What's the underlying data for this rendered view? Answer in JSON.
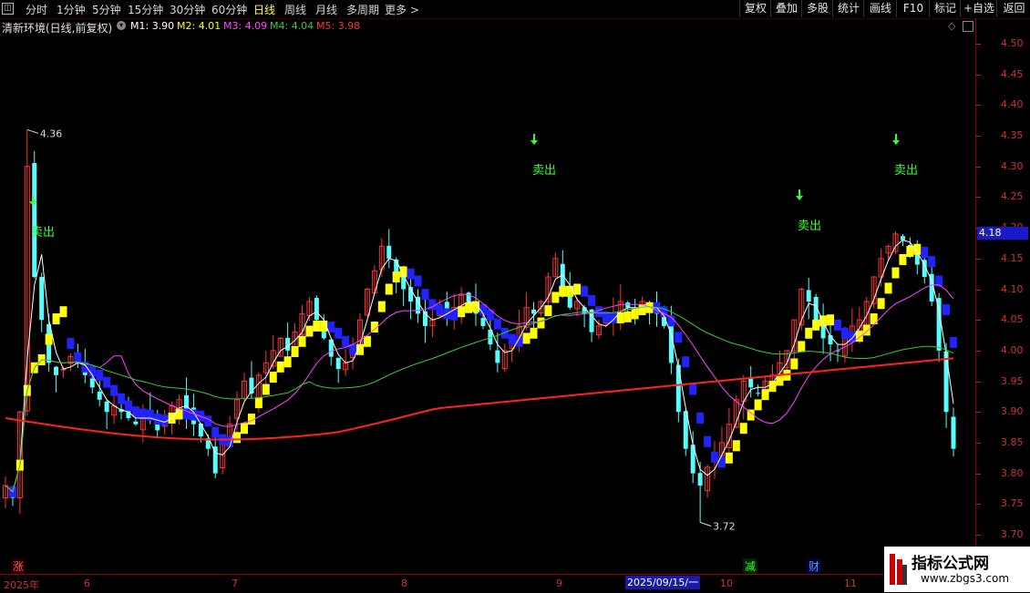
{
  "toolbar": {
    "timeframes": [
      "分时",
      "1分钟",
      "5分钟",
      "15分钟",
      "30分钟",
      "60分钟",
      "日线",
      "周线",
      "月线",
      "多周期",
      "更多 >"
    ],
    "active_index": 6,
    "right_buttons": [
      "复权",
      "叠加",
      "多股",
      "统计",
      "画线",
      "F10",
      "+自选",
      "返回"
    ]
  },
  "info": {
    "title": "清新环境(日线,前复权)",
    "m1": "M1: 3.90",
    "m2": "M2: 4.01",
    "m3": "M3: 4.09",
    "m4": "M4: 4.04",
    "m5": "M5: 3.98"
  },
  "price_badge": "4.18",
  "annotations": {
    "high_label": "4.36",
    "low_label": "3.72",
    "sell_label": "卖出",
    "zhang": "涨",
    "jian": "减",
    "cai": "财"
  },
  "date_axis": {
    "labels": [
      "2025年",
      "6",
      "7",
      "8",
      "9",
      "10",
      "11"
    ],
    "cursor_label": "2025/09/15/一"
  },
  "watermark": {
    "title": "指标公式网",
    "url": "www.zbgs3.com"
  },
  "colors": {
    "up": "#ff3333",
    "down": "#55ffff",
    "yellow": "#ffff00",
    "blue": "#2222ff",
    "m1": "#ffffff",
    "m2": "#ffff00",
    "m3": "#ff44ff",
    "m4": "#33cc33",
    "m5": "#ff2222"
  },
  "chart_data": {
    "type": "candlestick",
    "title": "清新环境(日线,前复权)",
    "y_ticks": [
      4.5,
      4.45,
      4.4,
      4.35,
      4.3,
      4.25,
      4.2,
      4.15,
      4.1,
      4.05,
      4.0,
      3.95,
      3.9,
      3.85,
      3.8,
      3.75,
      3.7
    ],
    "ylim": [
      3.67,
      4.53
    ],
    "close_path": [
      3.78,
      3.76,
      3.9,
      4.3,
      4.12,
      4.05,
      3.98,
      3.96,
      3.97,
      3.99,
      3.98,
      3.96,
      3.94,
      3.92,
      3.9,
      3.91,
      3.9,
      3.89,
      3.88,
      3.9,
      3.89,
      3.87,
      3.89,
      3.91,
      3.92,
      3.9,
      3.88,
      3.86,
      3.84,
      3.8,
      3.85,
      3.88,
      3.92,
      3.95,
      3.93,
      3.96,
      3.98,
      4.0,
      4.02,
      4.0,
      4.03,
      4.06,
      4.08,
      4.05,
      4.02,
      3.99,
      3.97,
      3.98,
      4.0,
      4.05,
      4.1,
      4.13,
      4.17,
      4.15,
      4.12,
      4.1,
      4.08,
      4.06,
      4.04,
      4.05,
      4.07,
      4.06,
      4.07,
      4.09,
      4.08,
      4.06,
      4.04,
      4.01,
      3.98,
      4.0,
      4.02,
      4.04,
      4.07,
      4.06,
      4.08,
      4.12,
      4.15,
      4.1,
      4.07,
      4.08,
      4.06,
      4.03,
      4.04,
      4.05,
      4.06,
      4.08,
      4.07,
      4.06,
      4.08,
      4.07,
      4.06,
      4.04,
      3.98,
      3.9,
      3.84,
      3.8,
      3.78,
      3.81,
      3.83,
      3.85,
      3.88,
      3.92,
      3.95,
      3.94,
      3.93,
      3.95,
      3.96,
      3.98,
      4.0,
      4.05,
      4.1,
      4.08,
      4.04,
      4.02,
      4.01,
      4.0,
      4.02,
      4.04,
      4.05,
      4.08,
      4.12,
      4.15,
      4.17,
      4.19,
      4.18,
      4.16,
      4.14,
      4.12,
      4.08,
      4.0,
      3.9,
      3.84
    ],
    "high": 4.36,
    "low": 3.72,
    "last": 4.18,
    "ma": [
      {
        "name": "M1",
        "value": 3.9
      },
      {
        "name": "M2",
        "value": 4.01
      },
      {
        "name": "M3",
        "value": 4.09
      },
      {
        "name": "M4",
        "value": 4.04
      },
      {
        "name": "M5",
        "value": 3.98
      }
    ],
    "x_labels": [
      "2025年",
      "6",
      "7",
      "8",
      "9",
      "10",
      "11"
    ]
  }
}
